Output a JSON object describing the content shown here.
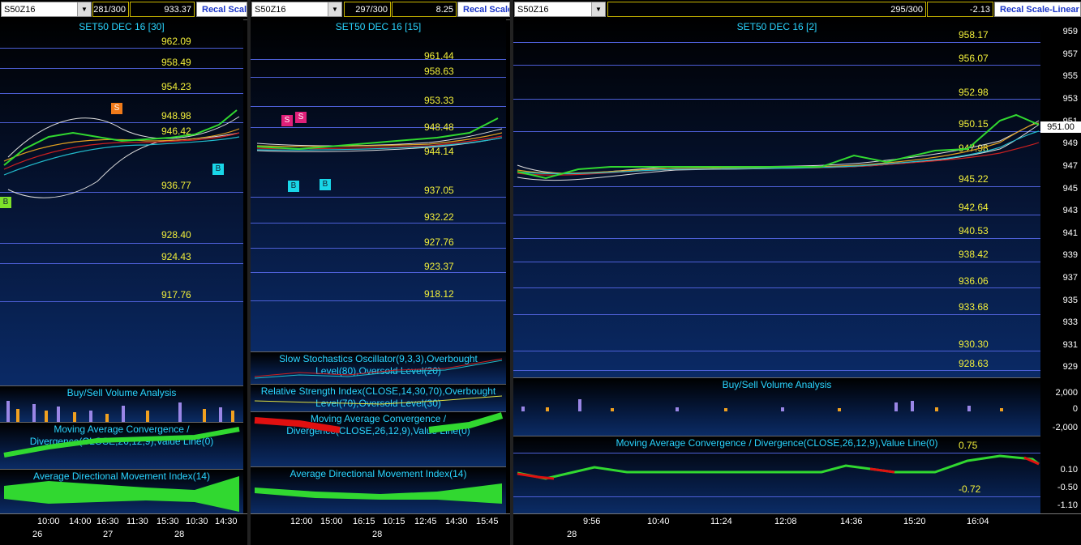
{
  "panel1": {
    "symbol": "S50Z16",
    "bars": "281/300",
    "value": "933.37",
    "recal": "Recal Scale",
    "title": "SET50 DEC 16  [30]",
    "levels": [
      "962.09",
      "958.49",
      "954.23",
      "948.98",
      "946.42",
      "936.77",
      "928.40",
      "924.43",
      "917.76"
    ],
    "markers": {
      "sell": "S",
      "buy1": "B",
      "buy2": "B"
    },
    "sub1": "Buy/Sell Volume Analysis",
    "sub2": "Moving Average Convergence / Divergence(CLOSE,26,12,9),Value Line(0)",
    "sub3": "Average Directional Movement Index(14)",
    "times": [
      "10:00",
      "14:00",
      "16:30",
      "11:30",
      "15:30",
      "10:30",
      "14:30"
    ],
    "dates": [
      "26",
      "27",
      "28"
    ]
  },
  "panel2": {
    "symbol": "S50Z16",
    "bars": "297/300",
    "value": "8.25",
    "recal": "Recal Scale",
    "title": "SET50 DEC 16  [15]",
    "levels": [
      "961.44",
      "958.63",
      "953.33",
      "948.48",
      "944.14",
      "937.05",
      "932.22",
      "927.76",
      "923.37",
      "918.12"
    ],
    "markers": {
      "sell1": "S",
      "sell2": "S",
      "buy1": "B",
      "buy2": "B"
    },
    "sub0": "Slow Stochastics Oscillator(9,3,3),Overbought Level(80),Oversold Level(20)",
    "sub1": "Relative Strength Index(CLOSE,14,30,70),Overbought Level(70),Oversold Level(30)",
    "sub2": "Moving Average Convergence / Divergence(CLOSE,26,12,9),Value Line(0)",
    "sub3": "Average Directional Movement Index(14)",
    "times": [
      "12:00",
      "15:00",
      "16:15",
      "10:15",
      "12:45",
      "14:30",
      "15:45"
    ],
    "dates": [
      "28"
    ]
  },
  "panel3": {
    "symbol": "S50Z16",
    "bars": "295/300",
    "value": "-2.13",
    "recal": "Recal Scale-Linear",
    "title": "SET50 DEC 16  [2]",
    "levels": [
      "958.17",
      "956.07",
      "952.98",
      "950.15",
      "947.98",
      "945.22",
      "942.64",
      "940.53",
      "938.42",
      "936.06",
      "933.68",
      "930.30",
      "928.63"
    ],
    "yticks": [
      "959",
      "957",
      "955",
      "953",
      "951",
      "949",
      "947",
      "945",
      "943",
      "941",
      "939",
      "937",
      "935",
      "933",
      "931",
      "929"
    ],
    "last_price": "951.00",
    "sub1": "Buy/Sell Volume Analysis",
    "sub1_ticks": [
      "2,000",
      "0",
      "-2,000"
    ],
    "sub2": "Moving Average Convergence / Divergence(CLOSE,26,12,9),Value Line(0)",
    "sub2_labels": [
      "0.75",
      "-0.72"
    ],
    "sub2_ticks": [
      "0.10",
      "-0.50",
      "-1.10"
    ],
    "times": [
      "9:56",
      "10:40",
      "11:24",
      "12:08",
      "14:36",
      "15:20",
      "16:04"
    ],
    "dates": [
      "28"
    ]
  }
}
